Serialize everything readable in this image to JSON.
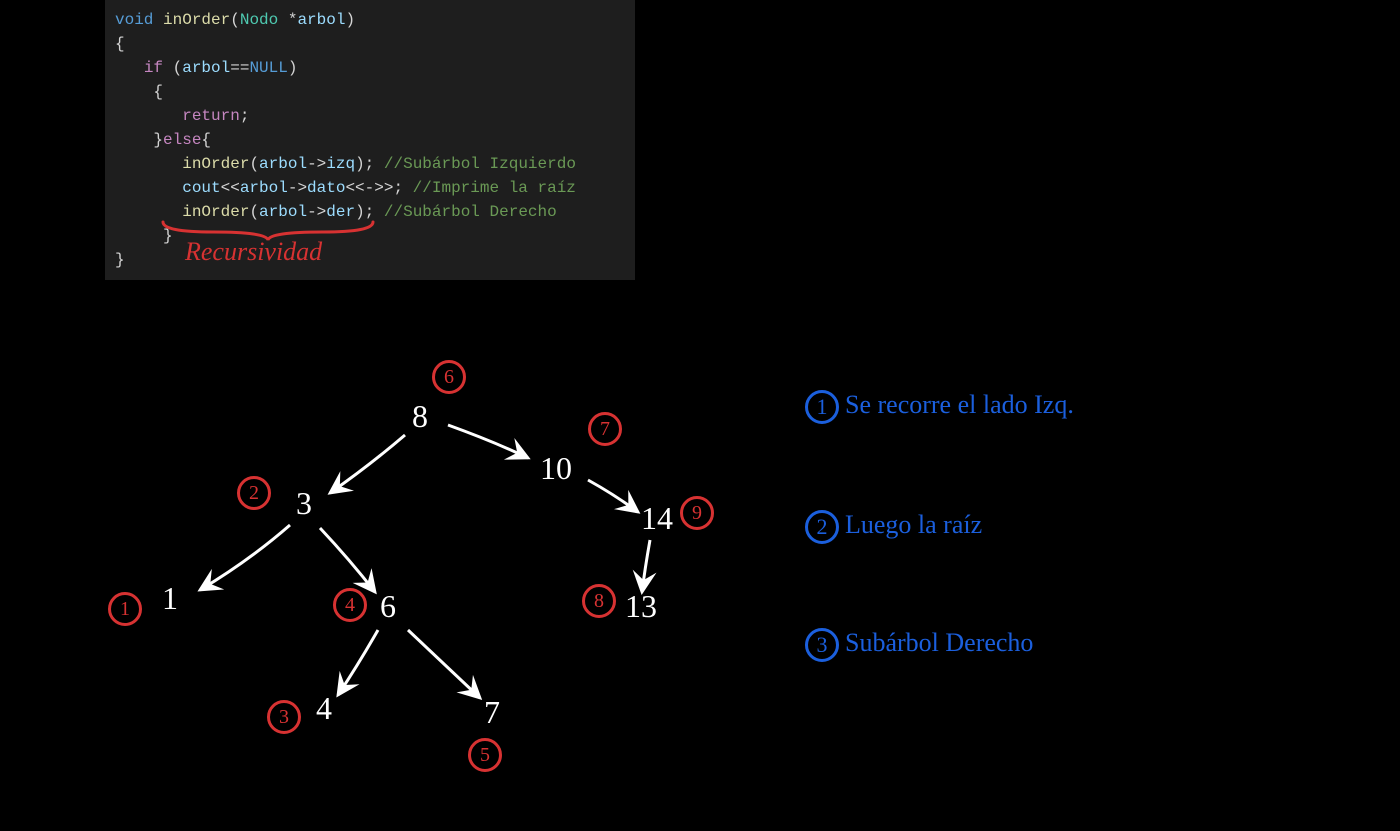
{
  "code": {
    "line1_void": "void",
    "line1_fn": "inOrder",
    "line1_type": "Nodo",
    "line1_param": "arbol",
    "line3_if": "if",
    "line3_var": "arbol",
    "line3_op": "==",
    "line3_null": "NULL",
    "line5_return": "return",
    "line6_else": "else",
    "line7_fn": "inOrder",
    "line7_var": "arbol",
    "line7_member": "izq",
    "line7_comment": "//Subárbol Izquierdo",
    "line8_cout": "cout",
    "line8_var": "arbol",
    "line8_member": "dato",
    "line8_op2": "<<->>",
    "line8_comment": "//Imprime la raíz",
    "line9_fn": "inOrder",
    "line9_var": "arbol",
    "line9_member": "der",
    "line9_comment": "//Subárbol Derecho"
  },
  "annotation": {
    "recursividad": "Recursividad"
  },
  "tree": {
    "nodes": {
      "n8": "8",
      "n3": "3",
      "n1": "1",
      "n6": "6",
      "n4": "4",
      "n7": "7",
      "n10": "10",
      "n14": "14",
      "n13": "13"
    },
    "order": {
      "o1": "1",
      "o2": "2",
      "o3": "3",
      "o4": "4",
      "o5": "5",
      "o6": "6",
      "o7": "7",
      "o8": "8",
      "o9": "9"
    }
  },
  "steps": {
    "s1_num": "1",
    "s1": "Se recorre el lado Izq.",
    "s2_num": "2",
    "s2": "Luego la raíz",
    "s3_num": "3",
    "s3": "Subárbol Derecho"
  }
}
